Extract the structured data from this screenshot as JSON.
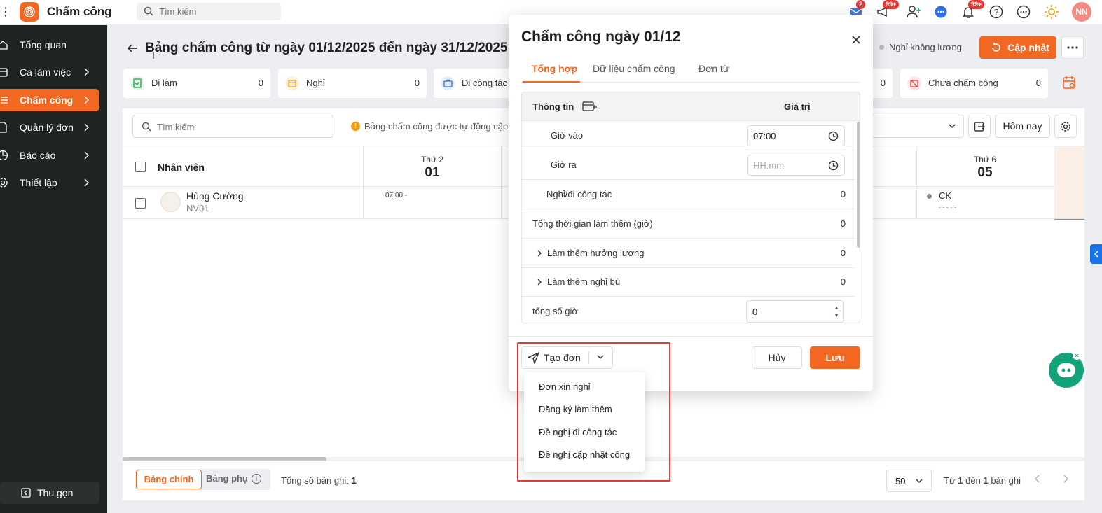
{
  "app": {
    "title": "Chấm công",
    "search_placeholder": "Tìm kiếm",
    "badges": {
      "mail": "2",
      "megaphone": "99+",
      "bell": "99+"
    },
    "user_initials": "NN",
    "brand_color": "#f26722"
  },
  "sidebar": {
    "items": [
      {
        "label": "Tổng quan",
        "icon": "home-icon"
      },
      {
        "label": "Ca làm việc",
        "icon": "calendar-icon"
      },
      {
        "label": "Chấm công",
        "icon": "list-icon"
      },
      {
        "label": "Quản lý đơn",
        "icon": "document-icon"
      },
      {
        "label": "Báo cáo",
        "icon": "pie-chart-icon"
      },
      {
        "label": "Thiết lập",
        "icon": "gear-icon"
      }
    ],
    "collapse_label": "Thu gọn"
  },
  "page": {
    "title": "Bảng chấm công từ ngày 01/12/2025 đến ngày 31/12/2025",
    "legend_unpaid": "Nghỉ không lương",
    "update_label": "Cập nhật"
  },
  "stats": [
    {
      "label": "Đi làm",
      "value": "0"
    },
    {
      "label": "Nghỉ",
      "value": "0"
    },
    {
      "label": "Đi công tác",
      "value": ""
    },
    {
      "label": "",
      "value": "0"
    },
    {
      "label": "Chưa chấm công",
      "value": "0"
    }
  ],
  "toolbar": {
    "search_placeholder": "Tìm kiếm",
    "info_text": "Bảng chấm công được tự động cập",
    "today_label": "Hôm nay"
  },
  "table": {
    "header_employee": "Nhân viên",
    "days": [
      {
        "weekday": "Thứ 2",
        "date": "01"
      },
      {
        "weekday": "Thứ 6",
        "date": "05"
      }
    ],
    "rows": [
      {
        "name": "Hùng Cường",
        "code": "NV01",
        "day01": "07:00 -",
        "day05_status": "CK",
        "day05_time": "-:- - -:-"
      }
    ]
  },
  "footer": {
    "tab_main": "Bảng chính",
    "tab_sub": "Bảng phụ",
    "total_label": "Tổng số bản ghi:",
    "total_value": "1",
    "page_size": "50",
    "range_from_label": "Từ",
    "range_from": "1",
    "range_to_label": "đến",
    "range_to": "1",
    "range_suffix": "bản ghi"
  },
  "modal": {
    "title": "Chấm công ngày 01/12",
    "tabs": [
      "Tổng hợp",
      "Dữ liệu chấm công",
      "Đơn từ"
    ],
    "col_info": "Thông tin",
    "col_value": "Giá trị",
    "rows": [
      {
        "label": "Giờ vào",
        "value": "07:00"
      },
      {
        "label": "Giờ ra",
        "placeholder": "HH:mm"
      },
      {
        "label": "Nghỉ/đi công tác",
        "value": "0"
      },
      {
        "label": "Tổng thời gian làm thêm (giờ)",
        "value": "0"
      },
      {
        "label": "Làm thêm hưởng lương",
        "value": "0"
      },
      {
        "label": "Làm thêm nghỉ bù",
        "value": "0"
      },
      {
        "label": "tổng số giờ",
        "value": "0"
      }
    ],
    "create_label": "Tạo đơn",
    "cancel_label": "Hủy",
    "save_label": "Lưu"
  },
  "dropdown": {
    "items": [
      "Đơn xin nghỉ",
      "Đăng ký làm thêm",
      "Đề nghị đi công tác",
      "Đề nghị cập nhật công"
    ]
  }
}
